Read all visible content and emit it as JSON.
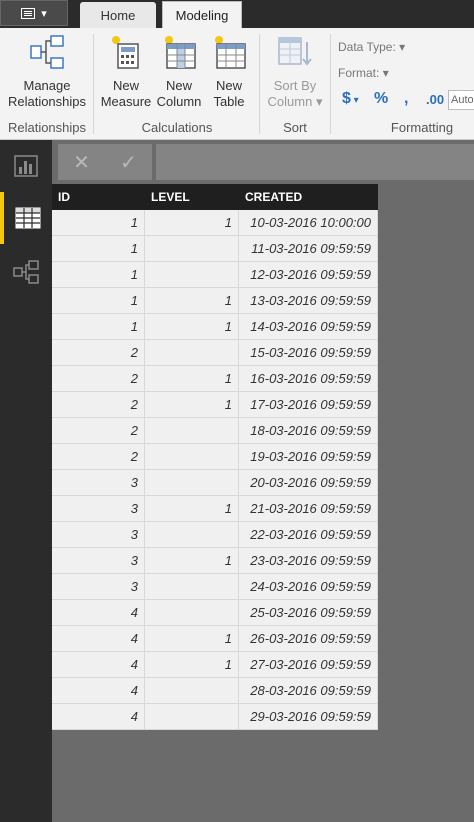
{
  "tabs": {
    "file_menu": "",
    "home": "Home",
    "modeling": "Modeling"
  },
  "ribbon": {
    "manage_relationships_line1": "Manage",
    "manage_relationships_line2": "Relationships",
    "new_measure_line1": "New",
    "new_measure_line2": "Measure",
    "new_column_line1": "New",
    "new_column_line2": "Column",
    "new_table_line1": "New",
    "new_table_line2": "Table",
    "sort_by_line1": "Sort By",
    "sort_by_line2": "Column",
    "groups": {
      "relationships": "Relationships",
      "calculations": "Calculations",
      "sort": "Sort",
      "formatting": "Formatting"
    },
    "data_type_label": "Data Type:",
    "format_label": "Format:",
    "currency_symbol": "$",
    "percent_symbol": "%",
    "comma_symbol": ",",
    "decimal_symbol": ".00",
    "auto_value": "Auto"
  },
  "grid": {
    "columns": [
      "ID",
      "LEVEL",
      "CREATED"
    ],
    "rows": [
      [
        "1",
        "1",
        "10-03-2016 10:00:00"
      ],
      [
        "1",
        "",
        "11-03-2016 09:59:59"
      ],
      [
        "1",
        "",
        "12-03-2016 09:59:59"
      ],
      [
        "1",
        "1",
        "13-03-2016 09:59:59"
      ],
      [
        "1",
        "1",
        "14-03-2016 09:59:59"
      ],
      [
        "2",
        "",
        "15-03-2016 09:59:59"
      ],
      [
        "2",
        "1",
        "16-03-2016 09:59:59"
      ],
      [
        "2",
        "1",
        "17-03-2016 09:59:59"
      ],
      [
        "2",
        "",
        "18-03-2016 09:59:59"
      ],
      [
        "2",
        "",
        "19-03-2016 09:59:59"
      ],
      [
        "3",
        "",
        "20-03-2016 09:59:59"
      ],
      [
        "3",
        "1",
        "21-03-2016 09:59:59"
      ],
      [
        "3",
        "",
        "22-03-2016 09:59:59"
      ],
      [
        "3",
        "1",
        "23-03-2016 09:59:59"
      ],
      [
        "3",
        "",
        "24-03-2016 09:59:59"
      ],
      [
        "4",
        "",
        "25-03-2016 09:59:59"
      ],
      [
        "4",
        "1",
        "26-03-2016 09:59:59"
      ],
      [
        "4",
        "1",
        "27-03-2016 09:59:59"
      ],
      [
        "4",
        "",
        "28-03-2016 09:59:59"
      ],
      [
        "4",
        "",
        "29-03-2016 09:59:59"
      ]
    ]
  },
  "formula_bar": {
    "cancel_glyph": "✕",
    "commit_glyph": "✓"
  },
  "colors": {
    "accent": "#f2c811",
    "sidebar": "#2b2b2b",
    "header": "#1f1f1f"
  }
}
